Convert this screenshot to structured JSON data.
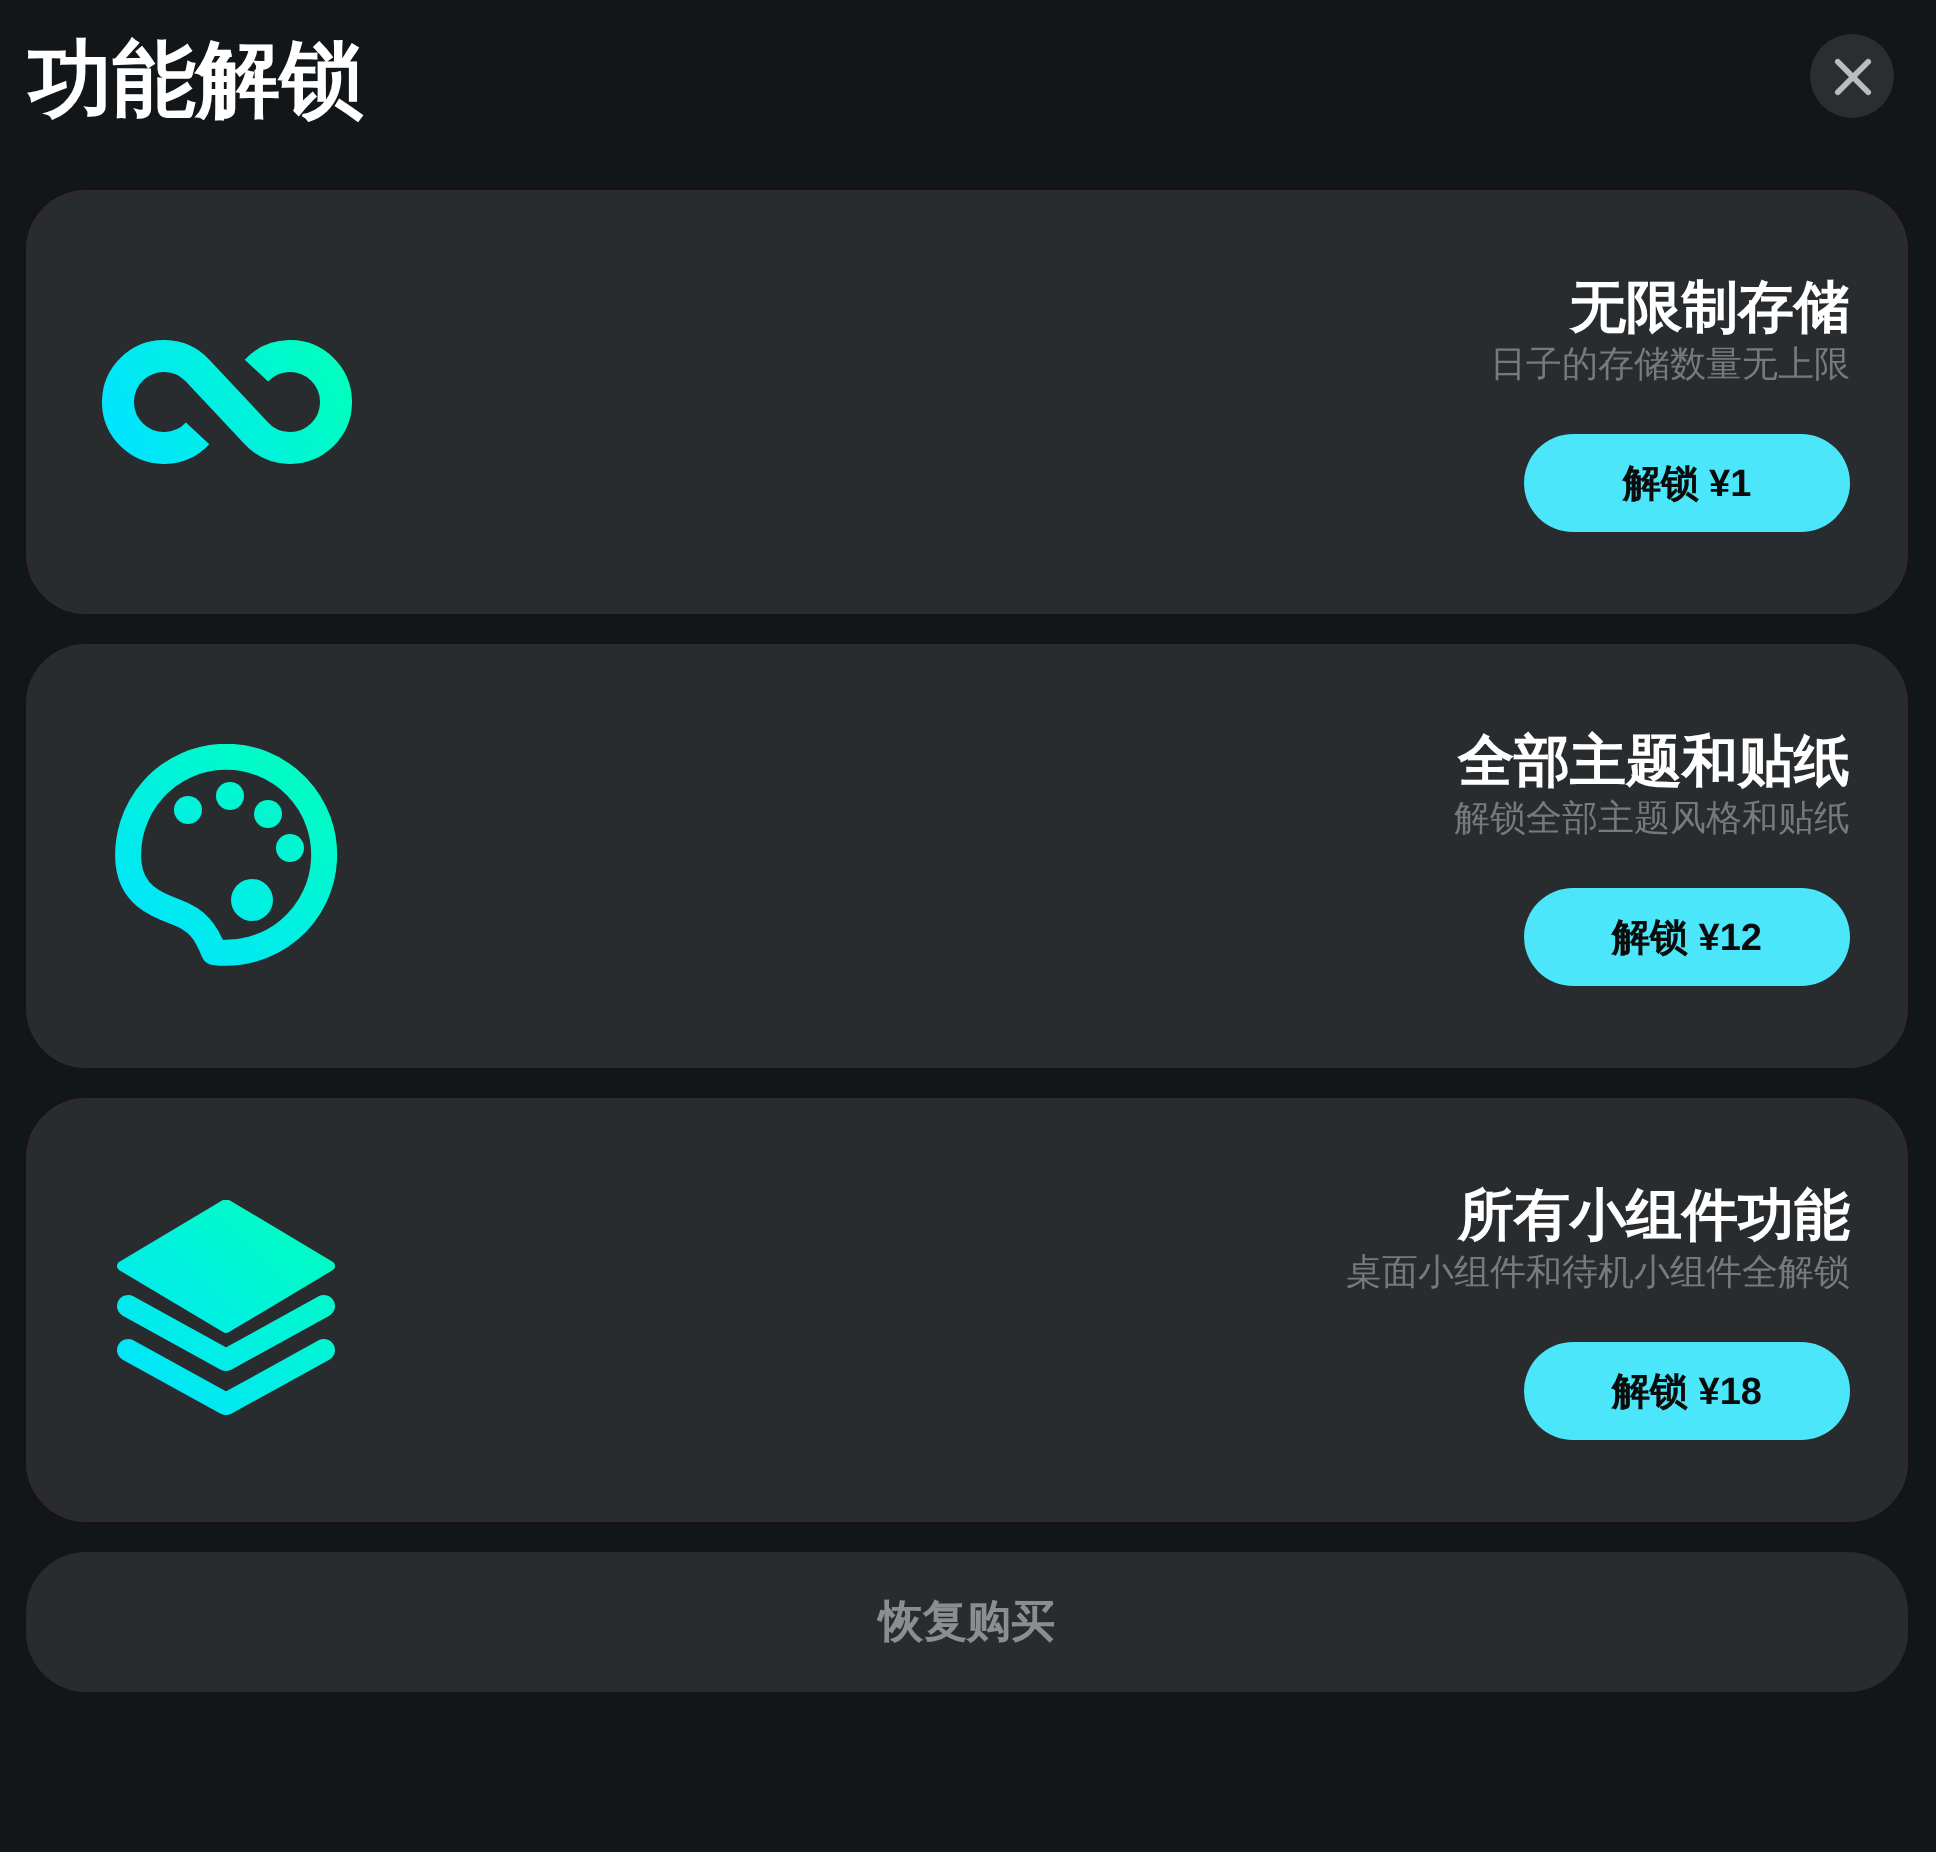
{
  "header": {
    "title": "功能解锁"
  },
  "features": [
    {
      "kind": "infinity",
      "title": "无限制存储",
      "description": "日子的存储数量无上限",
      "button": "解锁 ¥1"
    },
    {
      "kind": "palette",
      "title": "全部主题和贴纸",
      "description": "解锁全部主题风格和贴纸",
      "button": "解锁 ¥12"
    },
    {
      "kind": "layers",
      "title": "所有小组件功能",
      "description": "桌面小组件和待机小组件全解锁",
      "button": "解锁 ¥18"
    }
  ],
  "restore_button": "恢复购买"
}
